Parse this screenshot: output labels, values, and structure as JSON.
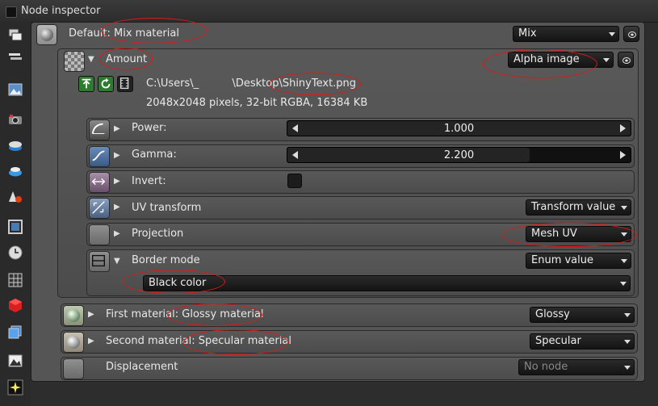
{
  "window": {
    "title": "Node inspector"
  },
  "default_row": {
    "label_prefix": "Default: ",
    "label_value": "Mix material",
    "dropdown": "Mix"
  },
  "amount": {
    "label": "Amount",
    "dropdown": "Alpha image"
  },
  "file": {
    "path_prefix": "C:\\Users\\_",
    "path_mid": "\\Desktop",
    "path_file": "\\ShinyText.png",
    "info": "2048x2048 pixels, 32-bit RGBA, 16384 KB"
  },
  "power": {
    "label": "Power:",
    "value": "1.000",
    "fraction": 1.0
  },
  "gamma": {
    "label": "Gamma:",
    "value": "2.200",
    "fraction": 0.733
  },
  "invert": {
    "label": "Invert:",
    "checked": false
  },
  "uv_transform": {
    "label": "UV transform",
    "dropdown": "Transform value"
  },
  "projection": {
    "label": "Projection",
    "dropdown": "Mesh UV"
  },
  "border_mode": {
    "label": "Border mode",
    "dropdown": "Enum value",
    "sub_dropdown": "Black color"
  },
  "first_material": {
    "label_prefix": "First material: ",
    "label_value": "Glossy material",
    "dropdown": "Glossy"
  },
  "second_material": {
    "label_prefix": "Second material: ",
    "label_value": "Specular material",
    "dropdown": "Specular"
  },
  "displacement": {
    "label": "Displacement",
    "dropdown": "No node"
  },
  "colors": {
    "annotation": "#e01818",
    "panel": "#555555",
    "background": "#2d2d2d"
  },
  "toolbar_icons": [
    "layers-icon",
    "list-icon",
    "image-icon",
    "camera-icon",
    "disk-icon",
    "disk-blue-icon",
    "material-icon",
    "frame-icon",
    "clock-icon",
    "grid-icon",
    "red-cube-icon",
    "blue-cube-icon",
    "landscape-icon",
    "sparkle-icon"
  ]
}
